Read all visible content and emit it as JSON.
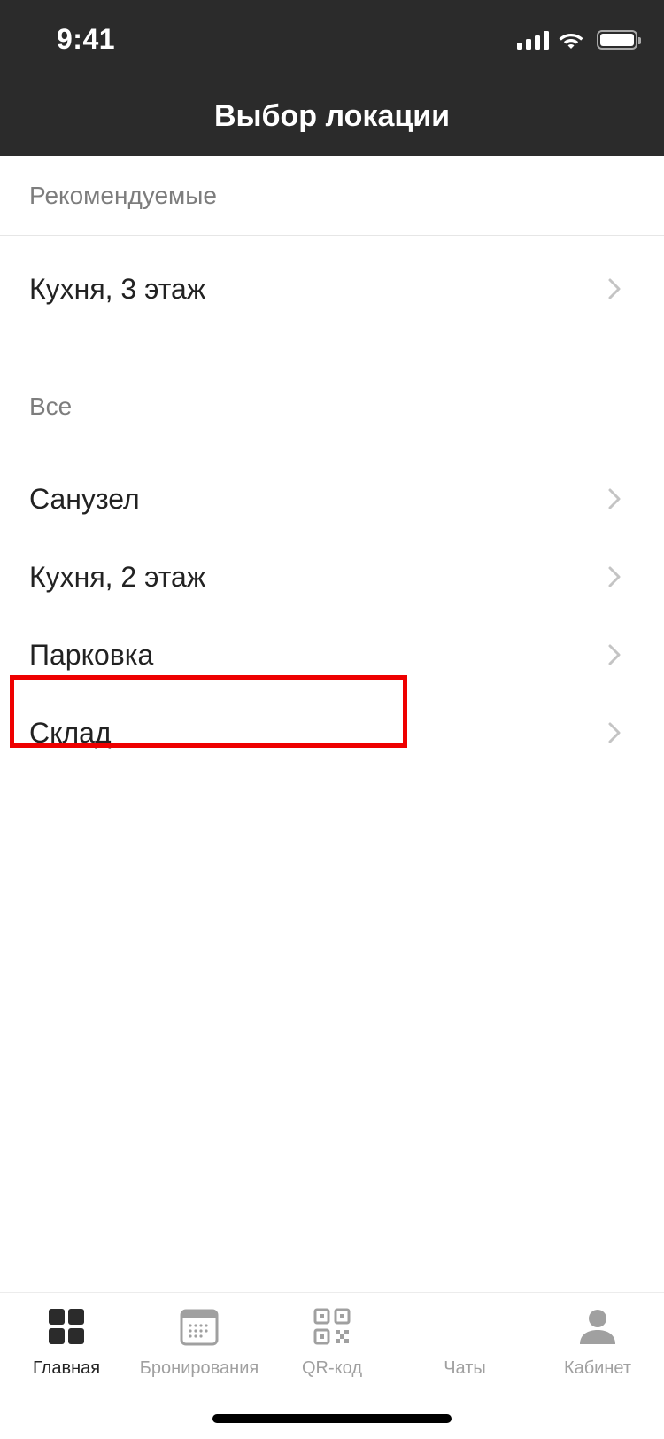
{
  "status_bar": {
    "time": "9:41"
  },
  "header": {
    "title": "Выбор локации",
    "background": "#2b2b2b"
  },
  "sections": [
    {
      "title": "Рекомендуемые",
      "items": [
        {
          "label": "Кухня, 3 этаж"
        }
      ]
    },
    {
      "title": "Все",
      "items": [
        {
          "label": "Санузел"
        },
        {
          "label": "Кухня, 2 этаж"
        },
        {
          "label": "Парковка"
        },
        {
          "label": "Склад"
        }
      ]
    }
  ],
  "highlight": {
    "color": "#ee0000",
    "item": "Склад"
  },
  "tabbar": {
    "tabs": [
      {
        "label": "Главная",
        "icon": "grid-icon",
        "active": true
      },
      {
        "label": "Бронирования",
        "icon": "calendar-icon",
        "active": false
      },
      {
        "label": "QR-код",
        "icon": "qr-code-icon",
        "active": false
      },
      {
        "label": "Чаты",
        "icon": "chat-icon",
        "active": false
      },
      {
        "label": "Кабинет",
        "icon": "person-icon",
        "active": false
      }
    ]
  }
}
